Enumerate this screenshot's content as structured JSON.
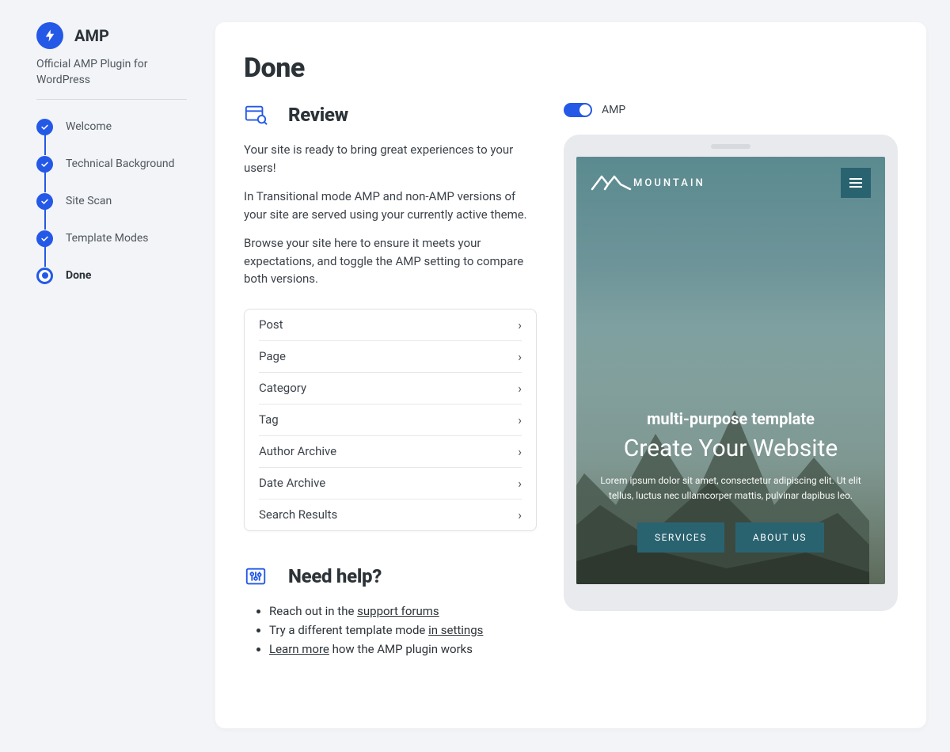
{
  "sidebar": {
    "brand": "AMP",
    "subtitle": "Official AMP Plugin for WordPress",
    "steps": [
      {
        "label": "Welcome",
        "state": "done"
      },
      {
        "label": "Technical Background",
        "state": "done"
      },
      {
        "label": "Site Scan",
        "state": "done"
      },
      {
        "label": "Template Modes",
        "state": "done"
      },
      {
        "label": "Done",
        "state": "current"
      }
    ]
  },
  "page": {
    "title": "Done",
    "review": {
      "heading": "Review",
      "p1": "Your site is ready to bring great experiences to your users!",
      "p2": "In Transitional mode AMP and non-AMP versions of your site are served using your currently active theme.",
      "p3": "Browse your site here to ensure it meets your expectations, and toggle the AMP setting to compare both versions."
    },
    "types": [
      "Post",
      "Page",
      "Category",
      "Tag",
      "Author Archive",
      "Date Archive",
      "Search Results"
    ],
    "help": {
      "heading": "Need help?",
      "items": [
        {
          "prefix": "Reach out in the ",
          "link": "support forums",
          "suffix": ""
        },
        {
          "prefix": "Try a different template mode ",
          "link": "in settings",
          "suffix": ""
        },
        {
          "prefix": "",
          "link": "Learn more",
          "suffix": " how the AMP plugin works"
        }
      ]
    }
  },
  "preview": {
    "toggle_label": "AMP",
    "toggle_on": true,
    "site_name": "MOUNTAIN",
    "hero_subtitle": "multi-purpose template",
    "hero_title": "Create Your Website",
    "hero_desc": "Lorem ipsum dolor sit amet, consectetur adipiscing elit. Ut elit tellus, luctus nec ullamcorper mattis, pulvinar dapibus leo.",
    "btn_services": "SERVICES",
    "btn_about": "ABOUT US"
  }
}
